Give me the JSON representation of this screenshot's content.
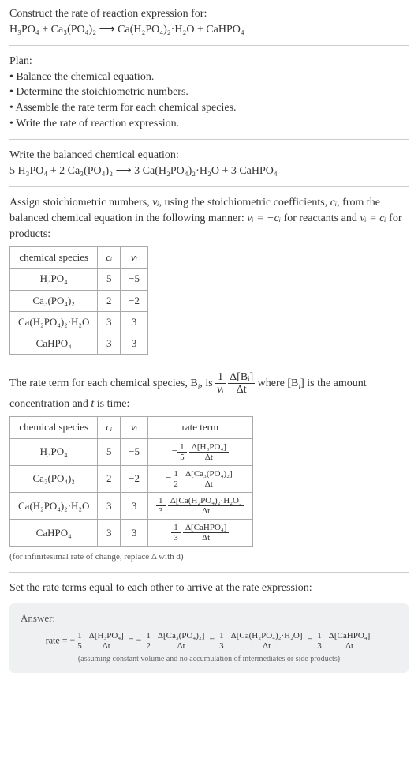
{
  "prompt": {
    "title": "Construct the rate of reaction expression for:",
    "equation": "H₃PO₄ + Ca₃(PO₄)₂ ⟶ Ca(H₂PO₄)₂·H₂O + CaHPO₄"
  },
  "plan": {
    "heading": "Plan:",
    "items": [
      "Balance the chemical equation.",
      "Determine the stoichiometric numbers.",
      "Assemble the rate term for each chemical species.",
      "Write the rate of reaction expression."
    ]
  },
  "balanced": {
    "heading": "Write the balanced chemical equation:",
    "equation": "5 H₃PO₄ + 2 Ca₃(PO₄)₂ ⟶ 3 Ca(H₂PO₄)₂·H₂O + 3 CaHPO₄"
  },
  "stoich": {
    "intro_a": "Assign stoichiometric numbers, ",
    "intro_b": ", using the stoichiometric coefficients, ",
    "intro_c": ", from the balanced chemical equation in the following manner: ",
    "intro_d": " for reactants and ",
    "intro_e": " for products:",
    "nu": "νᵢ",
    "ci": "cᵢ",
    "rel_react": "νᵢ = −cᵢ",
    "rel_prod": "νᵢ = cᵢ",
    "headers": {
      "species": "chemical species",
      "c": "cᵢ",
      "v": "νᵢ"
    },
    "rows": [
      {
        "species": "H₃PO₄",
        "c": "5",
        "v": "−5"
      },
      {
        "species": "Ca₃(PO₄)₂",
        "c": "2",
        "v": "−2"
      },
      {
        "species": "Ca(H₂PO₄)₂·H₂O",
        "c": "3",
        "v": "3"
      },
      {
        "species": "CaHPO₄",
        "c": "3",
        "v": "3"
      }
    ]
  },
  "rate_terms": {
    "intro_a": "The rate term for each chemical species, B",
    "intro_b": ", is ",
    "intro_c": " where [B",
    "intro_d": "] is the amount concentration and ",
    "intro_e": " is time:",
    "t": "t",
    "i": "i",
    "one": "1",
    "nu": "νᵢ",
    "delta_b": "Δ[Bᵢ]",
    "delta_t": "Δt",
    "headers": {
      "species": "chemical species",
      "c": "cᵢ",
      "v": "νᵢ",
      "rate": "rate term"
    },
    "rows": [
      {
        "species": "H₃PO₄",
        "c": "5",
        "v": "−5",
        "sign": "−",
        "fn": "1",
        "fd": "5",
        "bn": "Δ[H₃PO₄]",
        "bd": "Δt"
      },
      {
        "species": "Ca₃(PO₄)₂",
        "c": "2",
        "v": "−2",
        "sign": "−",
        "fn": "1",
        "fd": "2",
        "bn": "Δ[Ca₃(PO₄)₂]",
        "bd": "Δt"
      },
      {
        "species": "Ca(H₂PO₄)₂·H₂O",
        "c": "3",
        "v": "3",
        "sign": "",
        "fn": "1",
        "fd": "3",
        "bn": "Δ[Ca(H₂PO₄)₂·H₂O]",
        "bd": "Δt"
      },
      {
        "species": "CaHPO₄",
        "c": "3",
        "v": "3",
        "sign": "",
        "fn": "1",
        "fd": "3",
        "bn": "Δ[CaHPO₄]",
        "bd": "Δt"
      }
    ],
    "note": "(for infinitesimal rate of change, replace Δ with d)"
  },
  "final": {
    "heading": "Set the rate terms equal to each other to arrive at the rate expression:"
  },
  "answer": {
    "label": "Answer:",
    "lhs": "rate =",
    "terms": [
      {
        "sign": "−",
        "fn": "1",
        "fd": "5",
        "bn": "Δ[H₃PO₄]",
        "bd": "Δt"
      },
      {
        "sign": "= −",
        "fn": "1",
        "fd": "2",
        "bn": "Δ[Ca₃(PO₄)₂]",
        "bd": "Δt"
      },
      {
        "sign": "=",
        "fn": "1",
        "fd": "3",
        "bn": "Δ[Ca(H₂PO₄)₂·H₂O]",
        "bd": "Δt"
      },
      {
        "sign": "=",
        "fn": "1",
        "fd": "3",
        "bn": "Δ[CaHPO₄]",
        "bd": "Δt"
      }
    ],
    "note": "(assuming constant volume and no accumulation of intermediates or side products)"
  }
}
